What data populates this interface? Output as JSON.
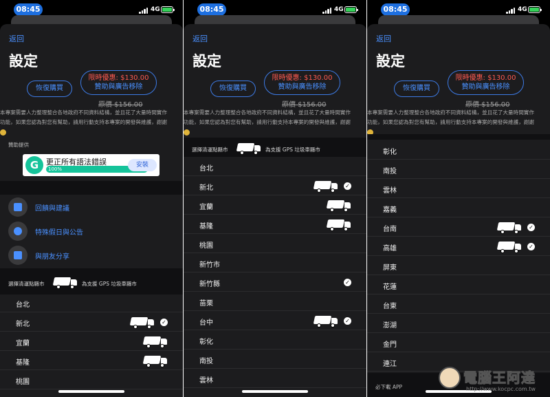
{
  "status": {
    "time": "08:45",
    "network": "4G"
  },
  "nav": {
    "back": "返回",
    "title": "設定"
  },
  "purchase": {
    "restore": "恢復購買",
    "promo_line1": "限時優惠: $130.00",
    "promo_line2": "贊助與廣告移除",
    "original_price": "原價 $156.00"
  },
  "description": {
    "line1": "本專案需要人力整理整合各地政府不同資料結構，並且花了大量時間實作",
    "line2": "功能，如果您認為對您有幫助，請用行動支持本專案的開發與維護，謝謝"
  },
  "sponsor": {
    "label": "贊助提供",
    "ad_title": "更正所有語法錯誤",
    "ad_progress": "100%",
    "ad_install": "安裝"
  },
  "menu": {
    "feedback": "回饋與建議",
    "holiday": "特殊假日與公告",
    "share": "與朋友分享"
  },
  "city_header": {
    "select": "選擇清運點縣市",
    "gps": "為支援 GPS 垃圾車縣市"
  },
  "cities": {
    "taipei": "台北",
    "new_taipei": "新北",
    "yilan": "宜蘭",
    "keelung": "基隆",
    "taoyuan": "桃園",
    "hsinchu_city": "新竹市",
    "hsinchu_county": "新竹縣",
    "miaoli": "苗栗",
    "taichung": "台中",
    "changhua": "彰化",
    "nantou": "南投",
    "yunlin": "雲林",
    "chiayi": "嘉義",
    "tainan": "台南",
    "kaohsiung": "高雄",
    "pingtung": "屏東",
    "hualien": "花蓮",
    "taitung": "台東",
    "penghu": "澎湖",
    "kinmen": "金門",
    "lienchiang": "連江"
  },
  "footer": {
    "must_download": "必下載 APP"
  },
  "watermark": {
    "name": "電腦王阿達",
    "url": "http://www.kocpc.com.tw"
  },
  "colors": {
    "accent": "#4a90ff",
    "promo": "#ff5a4f",
    "background": "#1c1c1e",
    "status_pill": "#1d6fe0"
  }
}
